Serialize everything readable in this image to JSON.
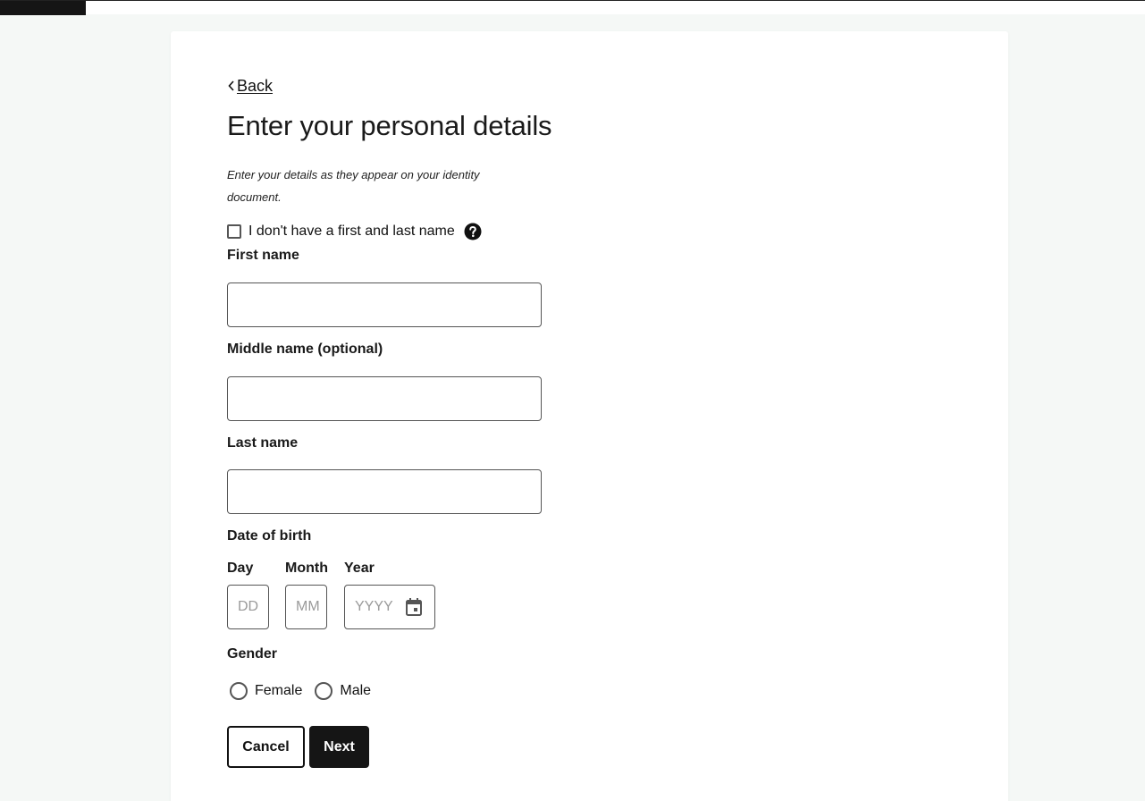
{
  "nav": {
    "back_label": "Back"
  },
  "page": {
    "title": "Enter your personal details",
    "intro": "Enter your details as they appear on your identity document."
  },
  "no_name_option": {
    "label": "I don't have a first and last name",
    "checked": false
  },
  "fields": {
    "first_name": {
      "label": "First name",
      "value": ""
    },
    "middle_name": {
      "label": "Middle name (optional)",
      "value": ""
    },
    "last_name": {
      "label": "Last name",
      "value": ""
    }
  },
  "dob": {
    "label": "Date of birth",
    "day": {
      "label": "Day",
      "placeholder": "DD"
    },
    "month": {
      "label": "Month",
      "placeholder": "MM"
    },
    "year": {
      "label": "Year",
      "placeholder": "YYYY"
    }
  },
  "gender": {
    "label": "Gender",
    "options": [
      {
        "label": "Female",
        "selected": false
      },
      {
        "label": "Male",
        "selected": false
      }
    ]
  },
  "actions": {
    "cancel_label": "Cancel",
    "next_label": "Next"
  },
  "icons": {
    "back": "chevron-left-icon",
    "help": "question-circle-icon",
    "calendar": "calendar-icon"
  }
}
